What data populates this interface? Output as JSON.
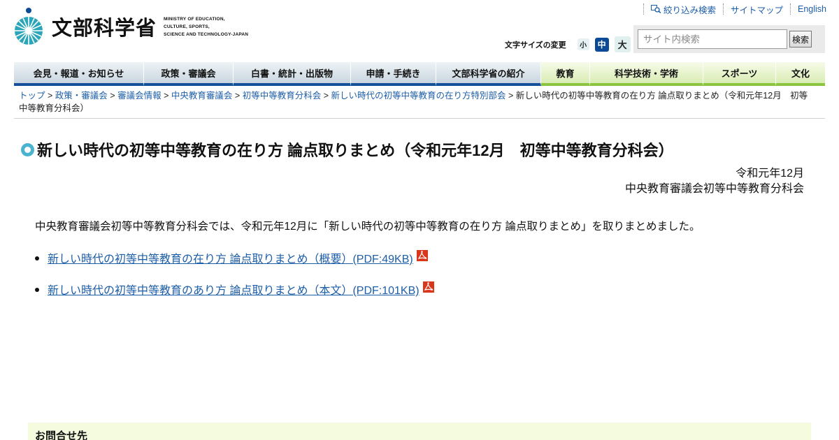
{
  "header": {
    "logo_kanji": "文部科学省",
    "logo_en_lines": [
      "MINISTRY OF EDUCATION,",
      "CULTURE, SPORTS,",
      "SCIENCE AND TECHNOLOGY-JAPAN"
    ],
    "util_links": {
      "filter_search": "絞り込み検索",
      "sitemap": "サイトマップ",
      "english": "English"
    },
    "fontsize": {
      "label": "文字サイズの変更",
      "small": "小",
      "medium": "中",
      "large": "大"
    },
    "search": {
      "placeholder": "サイト内検索",
      "button": "検索"
    }
  },
  "nav": {
    "items": [
      {
        "label": "会見・報道・お知らせ",
        "group": "blue"
      },
      {
        "label": "政策・審議会",
        "group": "blue"
      },
      {
        "label": "白書・統計・出版物",
        "group": "blue"
      },
      {
        "label": "申請・手続き",
        "group": "blue"
      },
      {
        "label": "文部科学省の紹介",
        "group": "blue"
      },
      {
        "label": "教育",
        "group": "green"
      },
      {
        "label": "科学技術・学術",
        "group": "green"
      },
      {
        "label": "スポーツ",
        "group": "green"
      },
      {
        "label": "文化",
        "group": "green"
      }
    ]
  },
  "breadcrumb": {
    "links": [
      "トップ",
      "政策・審議会",
      "審議会情報",
      "中央教育審議会",
      "初等中等教育分科会",
      "新しい時代の初等中等教育の在り方特別部会"
    ],
    "separator": ">",
    "current": "新しい時代の初等中等教育の在り方 論点取りまとめ（令和元年12月　初等中等教育分科会）"
  },
  "main": {
    "title": "新しい時代の初等中等教育の在り方 論点取りまとめ（令和元年12月　初等中等教育分科会）",
    "date": "令和元年12月",
    "org": "中央教育審議会初等中等教育分科会",
    "intro": "中央教育審議会初等中等教育分科会では、令和元年12月に「新しい時代の初等中等教育の在り方 論点取りまとめ」を取りまとめました。",
    "documents": [
      {
        "label": "新しい時代の初等中等教育の在り方 論点取りまとめ（概要）(PDF:49KB)",
        "icon": "pdf-icon"
      },
      {
        "label": "新しい時代の初等中等教育のあり方 論点取りまとめ（本文）(PDF:101KB)",
        "icon": "pdf-icon"
      }
    ]
  },
  "contact": {
    "title": "お問合せ先"
  },
  "colors": {
    "nav_blue": "#15509a",
    "nav_green": "#8bc53f",
    "link": "#1d5ea8",
    "logo_teal": "#2aa6b8",
    "contact_bg": "#f4fbdf"
  }
}
